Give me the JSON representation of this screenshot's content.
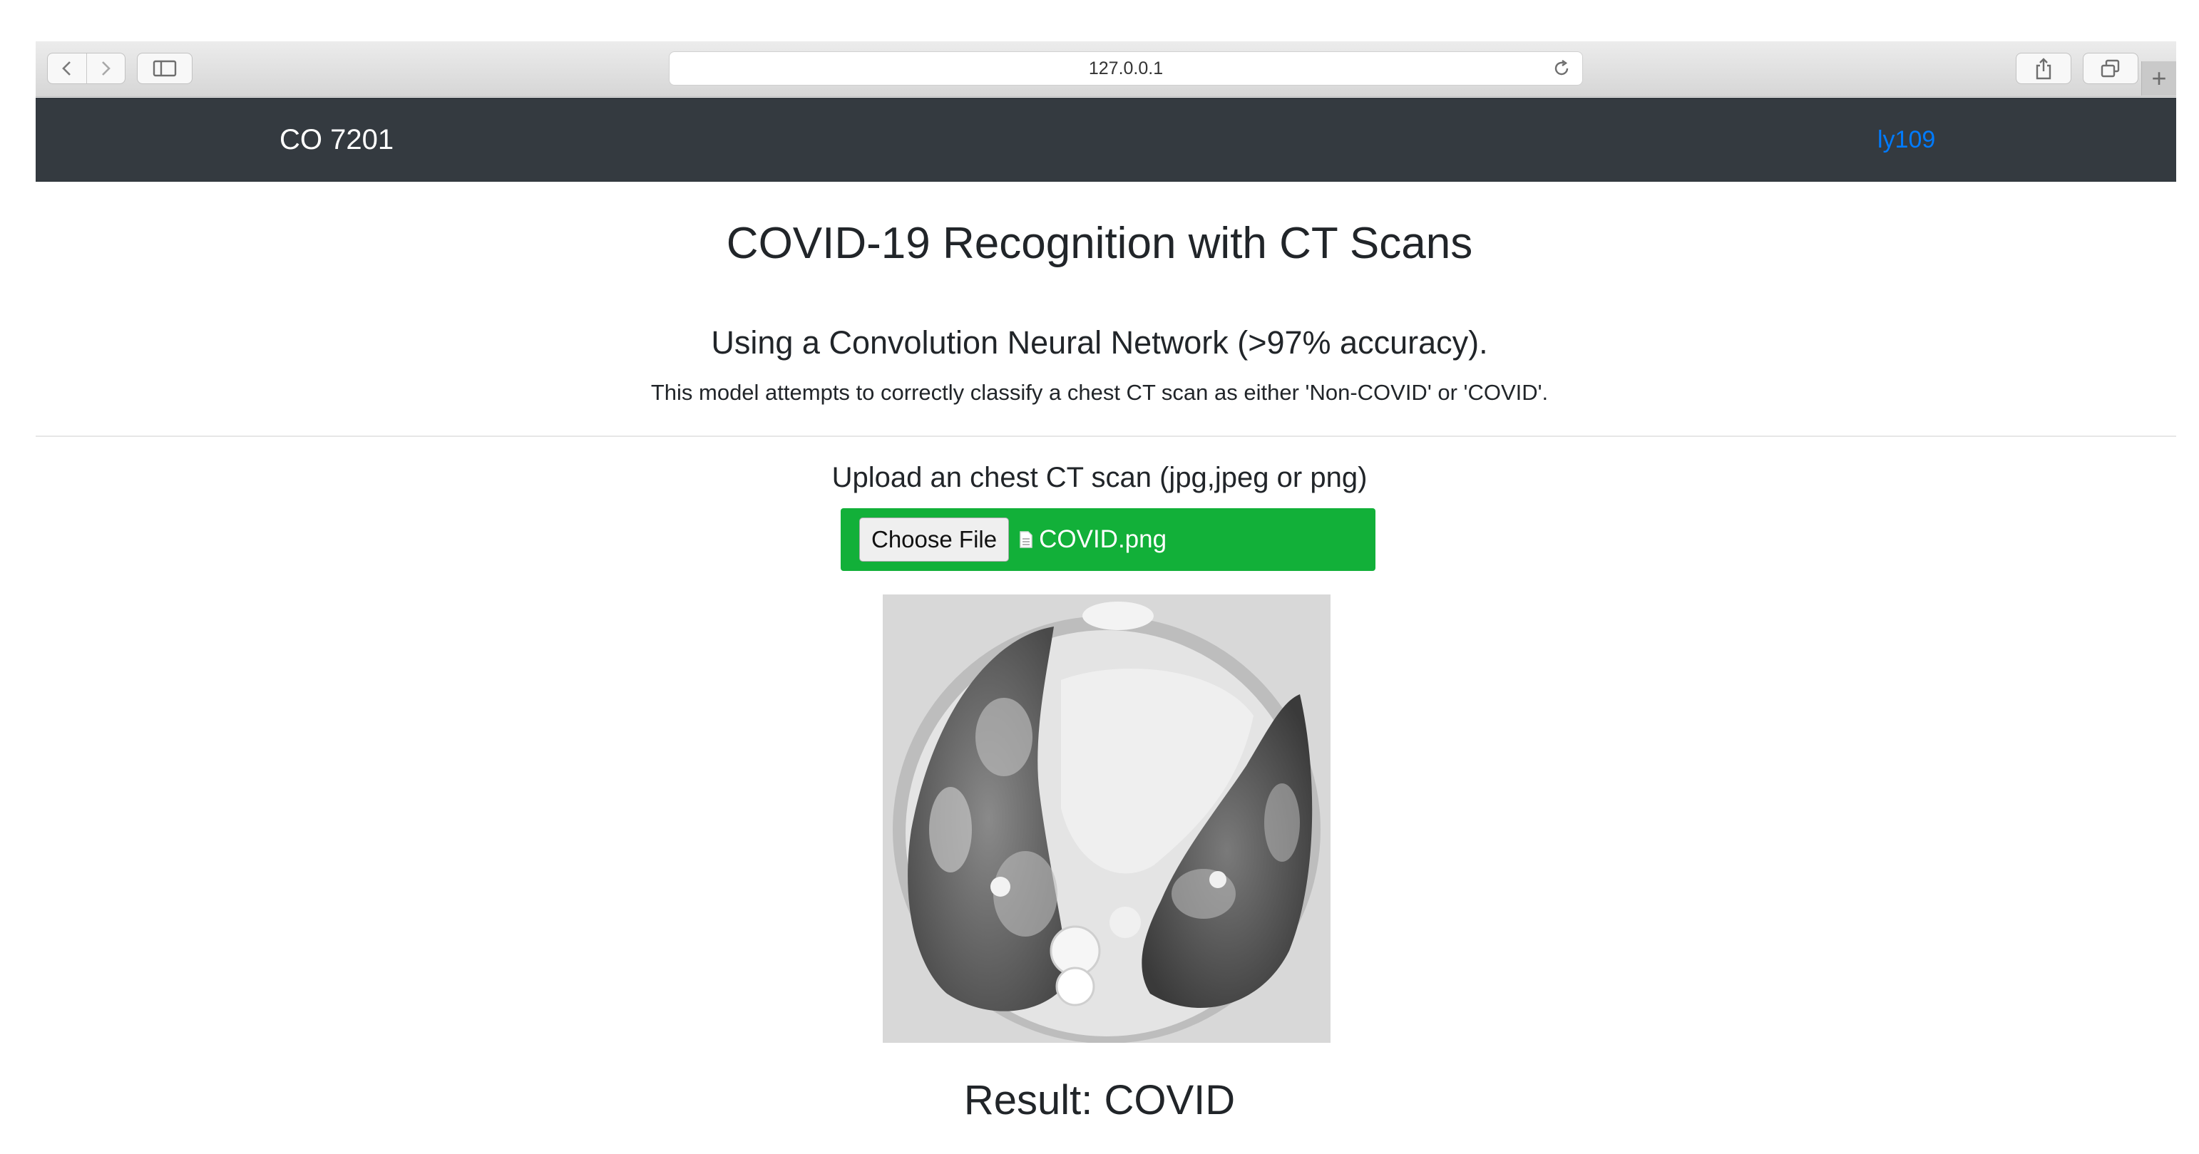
{
  "browser": {
    "address": "127.0.0.1",
    "icons": [
      "back-icon",
      "forward-icon",
      "sidebar-icon",
      "reload-icon",
      "share-icon",
      "tabs-icon",
      "plus-icon"
    ]
  },
  "navbar": {
    "brand": "CO 7201",
    "user": "ly109",
    "background": "#343a40",
    "link_color": "#007bff"
  },
  "main": {
    "title": "COVID-19 Recognition with CT Scans",
    "subtitle": "Using a Convolution Neural Network (>97% accuracy).",
    "description": "This model attempts to correctly classify a chest CT scan as either 'Non-COVID' or 'COVID'.",
    "upload_label": "Upload an chest CT scan (jpg,jpeg or png)",
    "choose_button": "Choose File",
    "file_name": "COVID.png",
    "upload_color": "#12b039",
    "result": "Result: COVID"
  }
}
